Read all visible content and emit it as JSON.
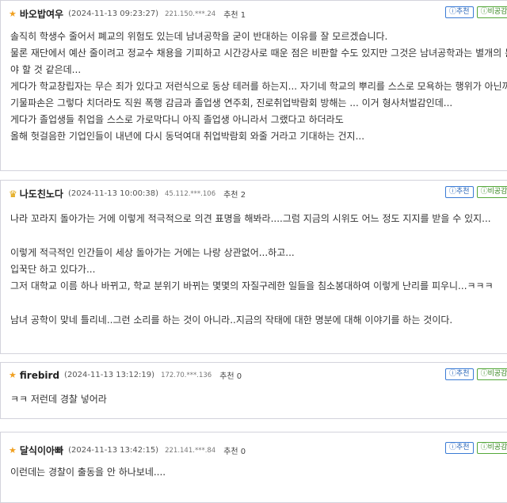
{
  "comments": [
    {
      "icon": "star-icon",
      "nick": "바오밥여우",
      "date": "(2024-11-13 09:23:27)",
      "ip": "221.150.***.24",
      "rec": "추천 1",
      "btn_rec": "ⓘ추천",
      "btn_dis": "ⓘ비공감",
      "lines": [
        "솔직히 학생수 줄어서 폐교의 위험도 있는데 남녀공학을 굳이 반대하는 이유를 잘 모르겠습니다.",
        "물론 재단에서  예산 줄이려고 정교수 채용을 기피하고 시간강사로 때운 점은 비판할 수도 있지만 그것은 남녀공학과는 별개의 문",
        "야 할 것 같은데...",
        "게다가 학교창립자는 무슨 죄가 있다고 저런식으로 동상 테러를 하는지... 자기네 학교의 뿌리를 스스로 모욕하는 행위가 아닌까요",
        "기물파손은 그렇다 치더라도 직원 폭행 감금과 졸업생 연주회, 진로취업박람회 방해는 ... 이거 형사처벌감인데...",
        "게다가 졸업생들 취업을 스스로 가로막다니 아직 졸업생 아니라서  그랬다고 하더라도",
        "올해 헛걸음한 기업인들이 내년에 다시 동덕여대 취업박람회 와줄 거라고 기대하는 건지..."
      ]
    },
    {
      "icon": "crown-icon",
      "nick": "나도친노다",
      "date": "(2024-11-13 10:00:38)",
      "ip": "45.112.***.106",
      "rec": "추천 2",
      "btn_rec": "ⓘ추천",
      "btn_dis": "ⓘ비공감",
      "lines": [
        "나라 꼬라지 돌아가는 거에 이렇게 적극적으로 의견 표명을 해봐라....그럼 지금의 시위도 어느 정도 지지를 받을 수 있지...",
        "",
        "이렇게 적극적인 인간들이 세상 돌아가는 거에는 나랑 상관없어...하고...",
        "입꾹단 하고 있다가...",
        "그저 대학교 이름 하나 바뀌고, 학교 분위기 바뀌는 몇몇의 자질구레한 일들을 침소봉대하여 이렇게 난리를 피우니...ㅋㅋㅋ",
        "",
        "남녀 공학이 맞네 틀리네..그런 소리를 하는 것이 아니라..지금의 작태에 대한 명분에 대해 이야기를 하는 것이다."
      ]
    },
    {
      "icon": "star-icon",
      "nick": "firebird",
      "date": "(2024-11-13 13:12:19)",
      "ip": "172.70.***.136",
      "rec": "추천 0",
      "btn_rec": "ⓘ추천",
      "btn_dis": "ⓘ비공감",
      "lines": [
        "ㅋㅋ  저런데 경찰 넣어라"
      ]
    },
    {
      "icon": "star-icon",
      "nick": "달식이아빠",
      "date": "(2024-11-13 13:42:15)",
      "ip": "221.141.***.84",
      "rec": "추천 0",
      "btn_rec": "ⓘ추천",
      "btn_dis": "ⓘ비공감",
      "lines": [
        "이런데는 경찰이 출동을 안 하나보네...."
      ]
    }
  ]
}
